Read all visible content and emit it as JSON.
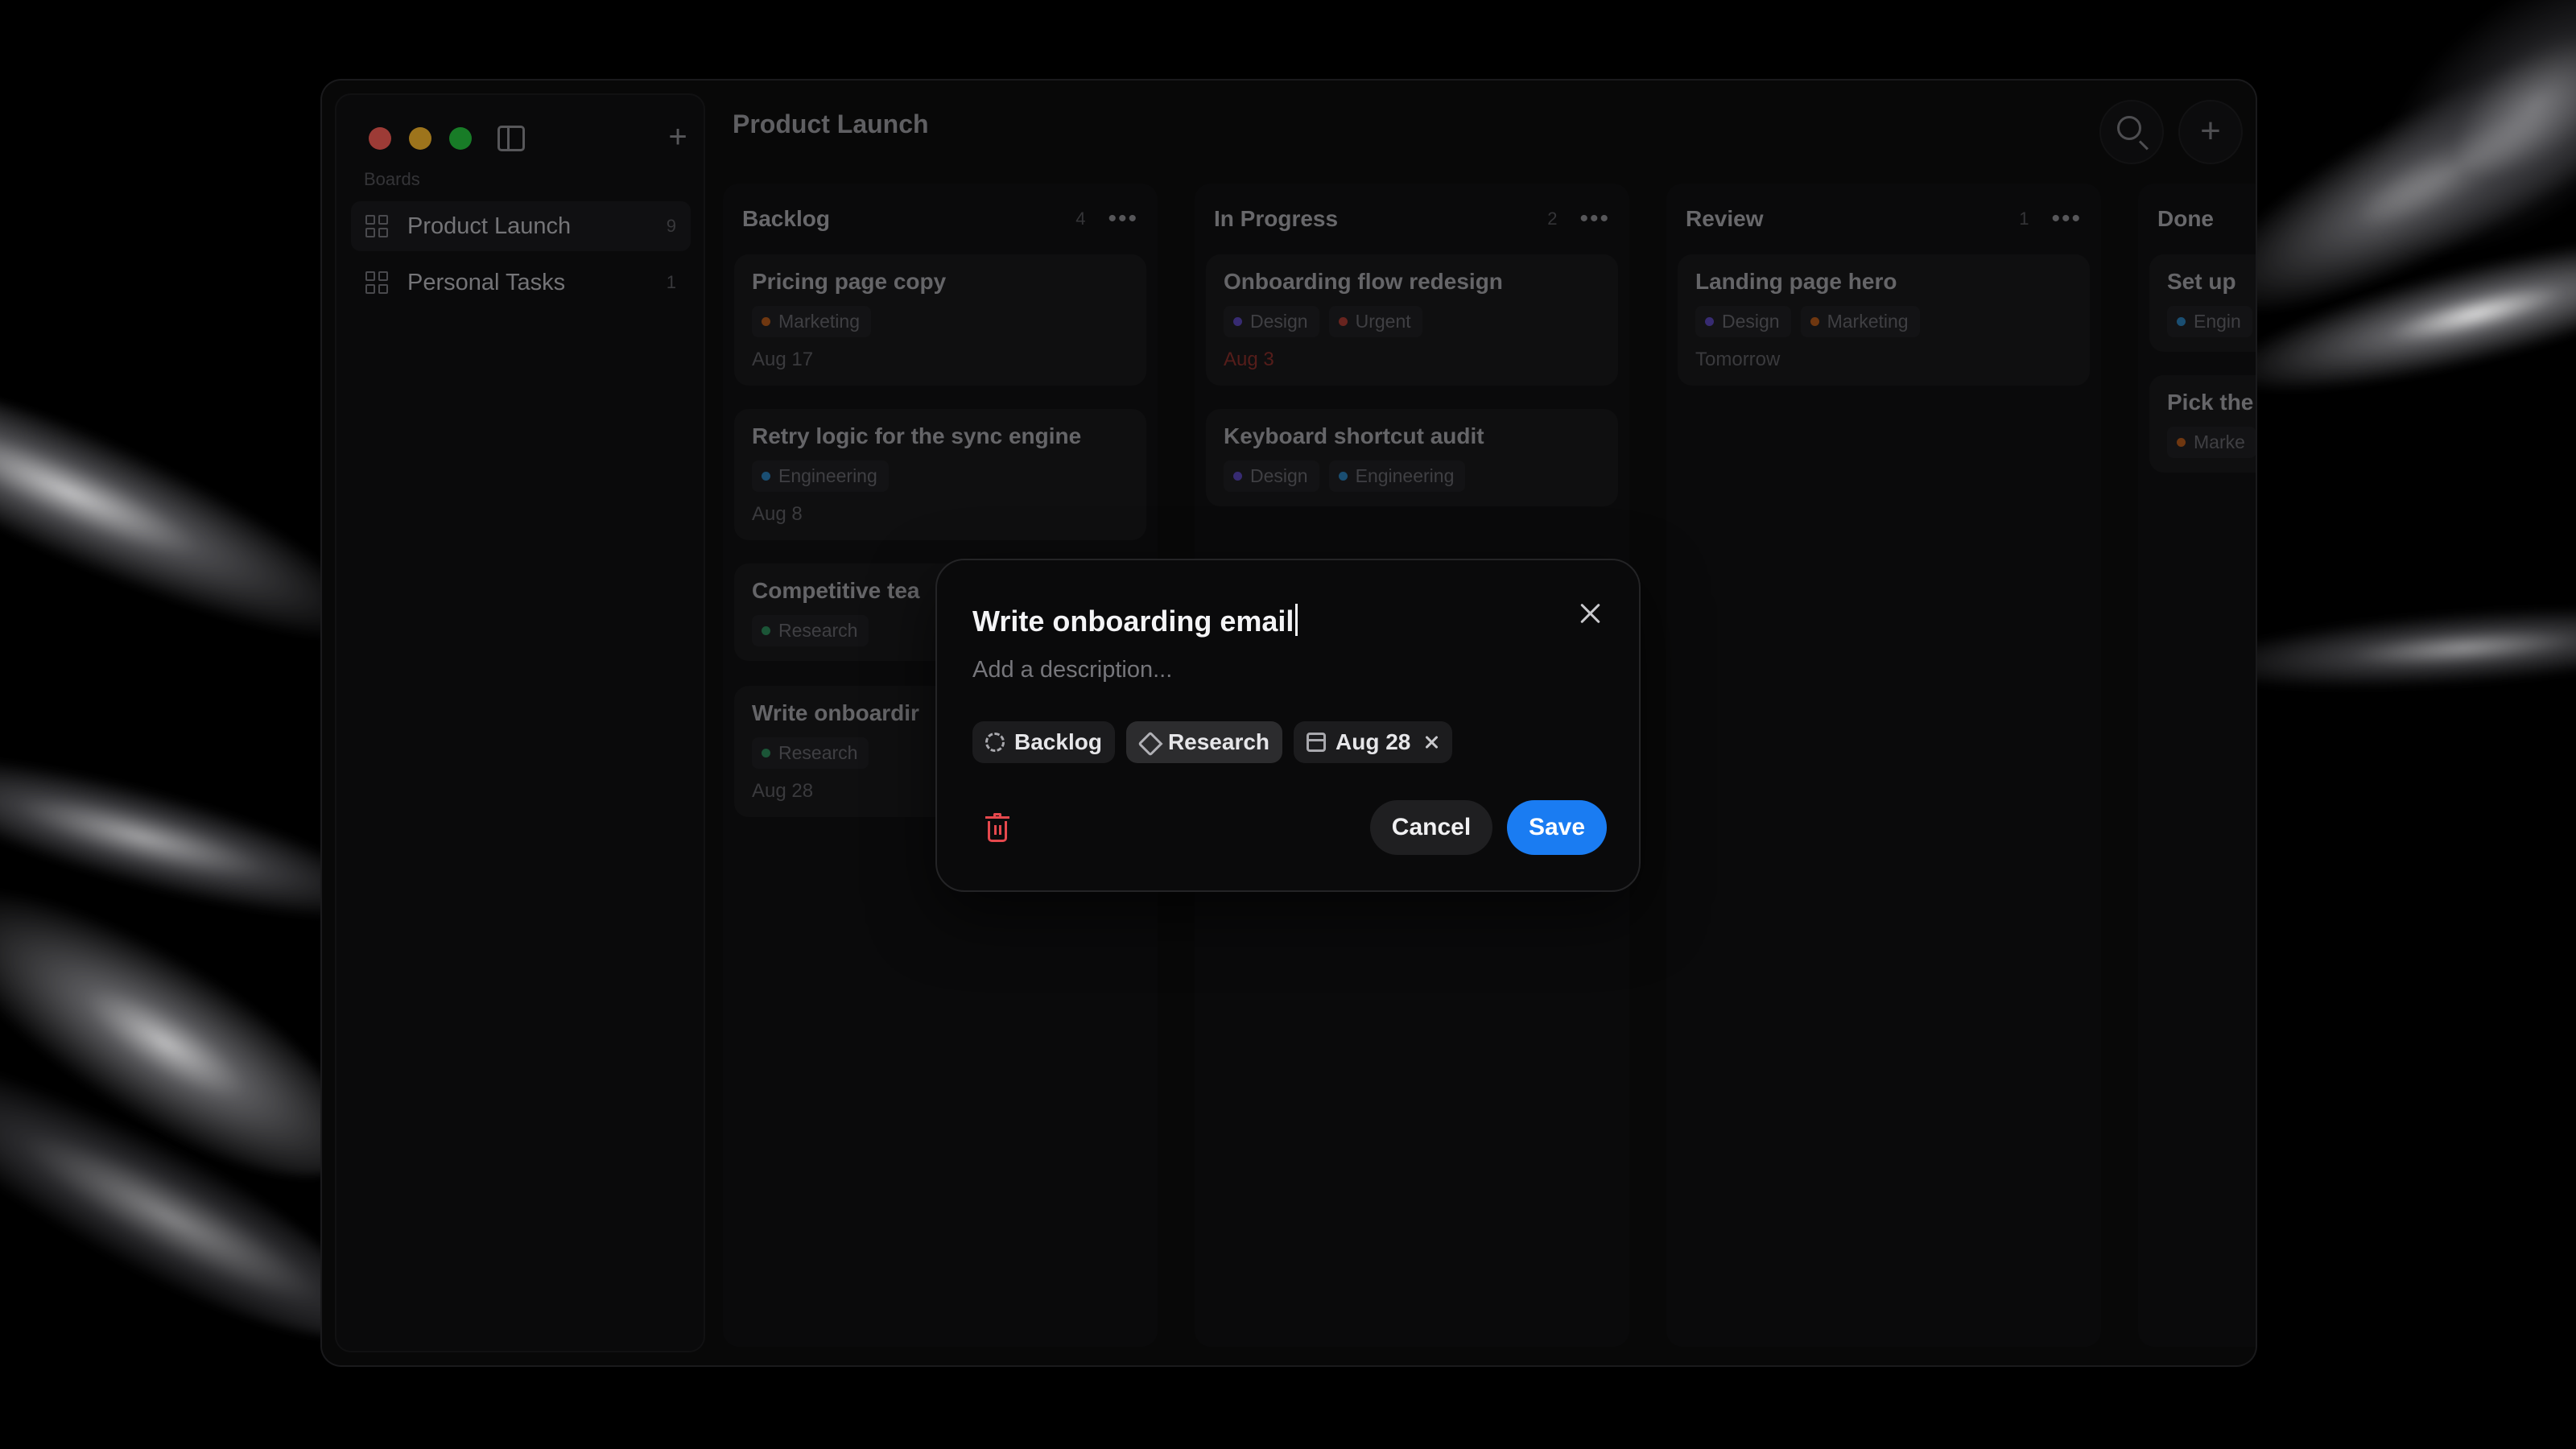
{
  "window": {
    "title": "Product Launch"
  },
  "sidebar": {
    "section_label": "Boards",
    "boards": [
      {
        "label": "Product Launch",
        "count": "9",
        "active": true
      },
      {
        "label": "Personal Tasks",
        "count": "1",
        "active": false
      }
    ]
  },
  "columns": [
    {
      "title": "Backlog",
      "count": "4",
      "cards": [
        {
          "title": "Pricing page copy",
          "tags": [
            {
              "label": "Marketing",
              "color": "#b45a1a"
            }
          ],
          "date": "Aug 17"
        },
        {
          "title": "Retry logic for the sync engine",
          "tags": [
            {
              "label": "Engineering",
              "color": "#2a7fb8"
            }
          ],
          "date": "Aug 8"
        },
        {
          "title": "Competitive tea",
          "tags": [
            {
              "label": "Research",
              "color": "#2d8a5a"
            }
          ],
          "date": ""
        },
        {
          "title": "Write onboardir",
          "tags": [
            {
              "label": "Research",
              "color": "#2d8a5a"
            }
          ],
          "date": "Aug 28"
        }
      ]
    },
    {
      "title": "In Progress",
      "count": "2",
      "cards": [
        {
          "title": "Onboarding flow redesign",
          "tags": [
            {
              "label": "Design",
              "color": "#5a46b8"
            },
            {
              "label": "Urgent",
              "color": "#a83a32"
            }
          ],
          "date": "Aug 3",
          "date_urgent": true
        },
        {
          "title": "Keyboard shortcut audit",
          "tags": [
            {
              "label": "Design",
              "color": "#5a46b8"
            },
            {
              "label": "Engineering",
              "color": "#2a7fb8"
            }
          ],
          "date": ""
        }
      ]
    },
    {
      "title": "Review",
      "count": "1",
      "cards": [
        {
          "title": "Landing page hero",
          "tags": [
            {
              "label": "Design",
              "color": "#5a46b8"
            },
            {
              "label": "Marketing",
              "color": "#b45a1a"
            }
          ],
          "date": "Tomorrow"
        }
      ]
    },
    {
      "title": "Done",
      "count": "",
      "cards": [
        {
          "title": "Set up",
          "tags": [
            {
              "label": "Engin",
              "color": "#2a7fb8"
            }
          ],
          "date": ""
        },
        {
          "title": "Pick the",
          "tags": [
            {
              "label": "Marke",
              "color": "#b45a1a"
            }
          ],
          "date": ""
        }
      ]
    }
  ],
  "modal": {
    "title": "Write onboarding email",
    "description_placeholder": "Add a description...",
    "status": "Backlog",
    "label": "Research",
    "due": "Aug 28",
    "cancel_label": "Cancel",
    "save_label": "Save"
  },
  "colors": {
    "accent": "#1a7cf2",
    "danger": "#e5484d"
  },
  "icons": {
    "sidebar_toggle": "sidebar-toggle-icon",
    "add": "plus-icon",
    "search": "search-icon",
    "board": "grid-icon",
    "more": "more-horizontal-icon",
    "close": "close-icon",
    "status": "status-dashed-circle-icon",
    "tag": "tag-icon",
    "calendar": "calendar-icon",
    "delete": "trash-icon"
  }
}
